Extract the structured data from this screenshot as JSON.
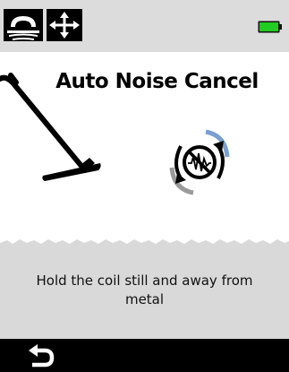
{
  "status_bar": {
    "mode_icon": "ground-mode-icon",
    "move_icon": "move-arrows-icon",
    "battery_icon": "battery-full-icon",
    "battery_color": "#22cc22",
    "battery_level": 1.0
  },
  "main": {
    "title": "Auto Noise Cancel",
    "instruction": "Hold the coil still and away from metal",
    "illustration_icon": "detector-coil-icon",
    "noise_icon": "noise-cancel-cycle-icon"
  },
  "bottom_bar": {
    "back_icon": "back-arrow-icon"
  },
  "colors": {
    "status_bg": "#dcdcdc",
    "panel_bg": "#d9d9d9",
    "bottom_bg": "#000000",
    "accent_blue": "#7a9fd0"
  }
}
